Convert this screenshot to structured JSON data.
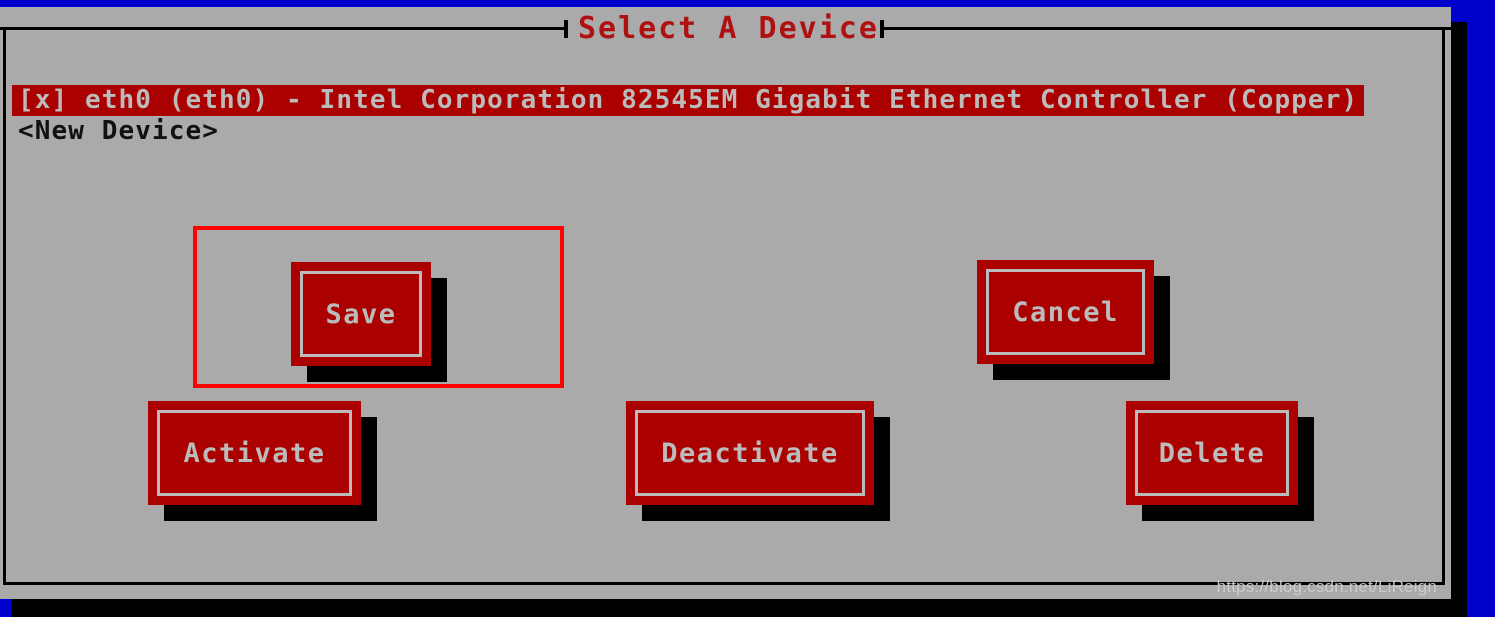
{
  "window": {
    "title": "Select A Device",
    "background_color": "#0000cc",
    "dialog_color": "#aaaaaa",
    "accent_color": "#aa0000",
    "annotation_color": "#ff0000",
    "text_color": "#bbbbbb"
  },
  "device_list": {
    "items": [
      {
        "label": "[x] eth0 (eth0) - Intel Corporation 82545EM Gigabit Ethernet Controller (Copper)",
        "selected": true
      },
      {
        "label": "<New Device>",
        "selected": false
      }
    ]
  },
  "buttons": {
    "save": "Save",
    "cancel": "Cancel",
    "activate": "Activate",
    "deactivate": "Deactivate",
    "delete": "Delete"
  },
  "watermark": {
    "text": "https://blog.csdn.net/LiReign"
  }
}
